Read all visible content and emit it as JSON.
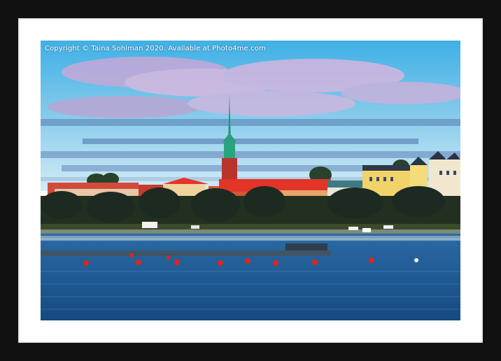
{
  "artwork": {
    "watermark": "Copyright  © Taina Sohlman  2020. Available at Photo4me.com",
    "frame_color": "#111111",
    "mount_color": "#ffffff"
  },
  "scene": {
    "sky_colors": [
      "#49b4e6",
      "#86cbe8",
      "#c9e7f2"
    ],
    "water_color": "#1e5a93",
    "spire_color": "#2aa37f",
    "buoy_color": "#e0241c"
  }
}
